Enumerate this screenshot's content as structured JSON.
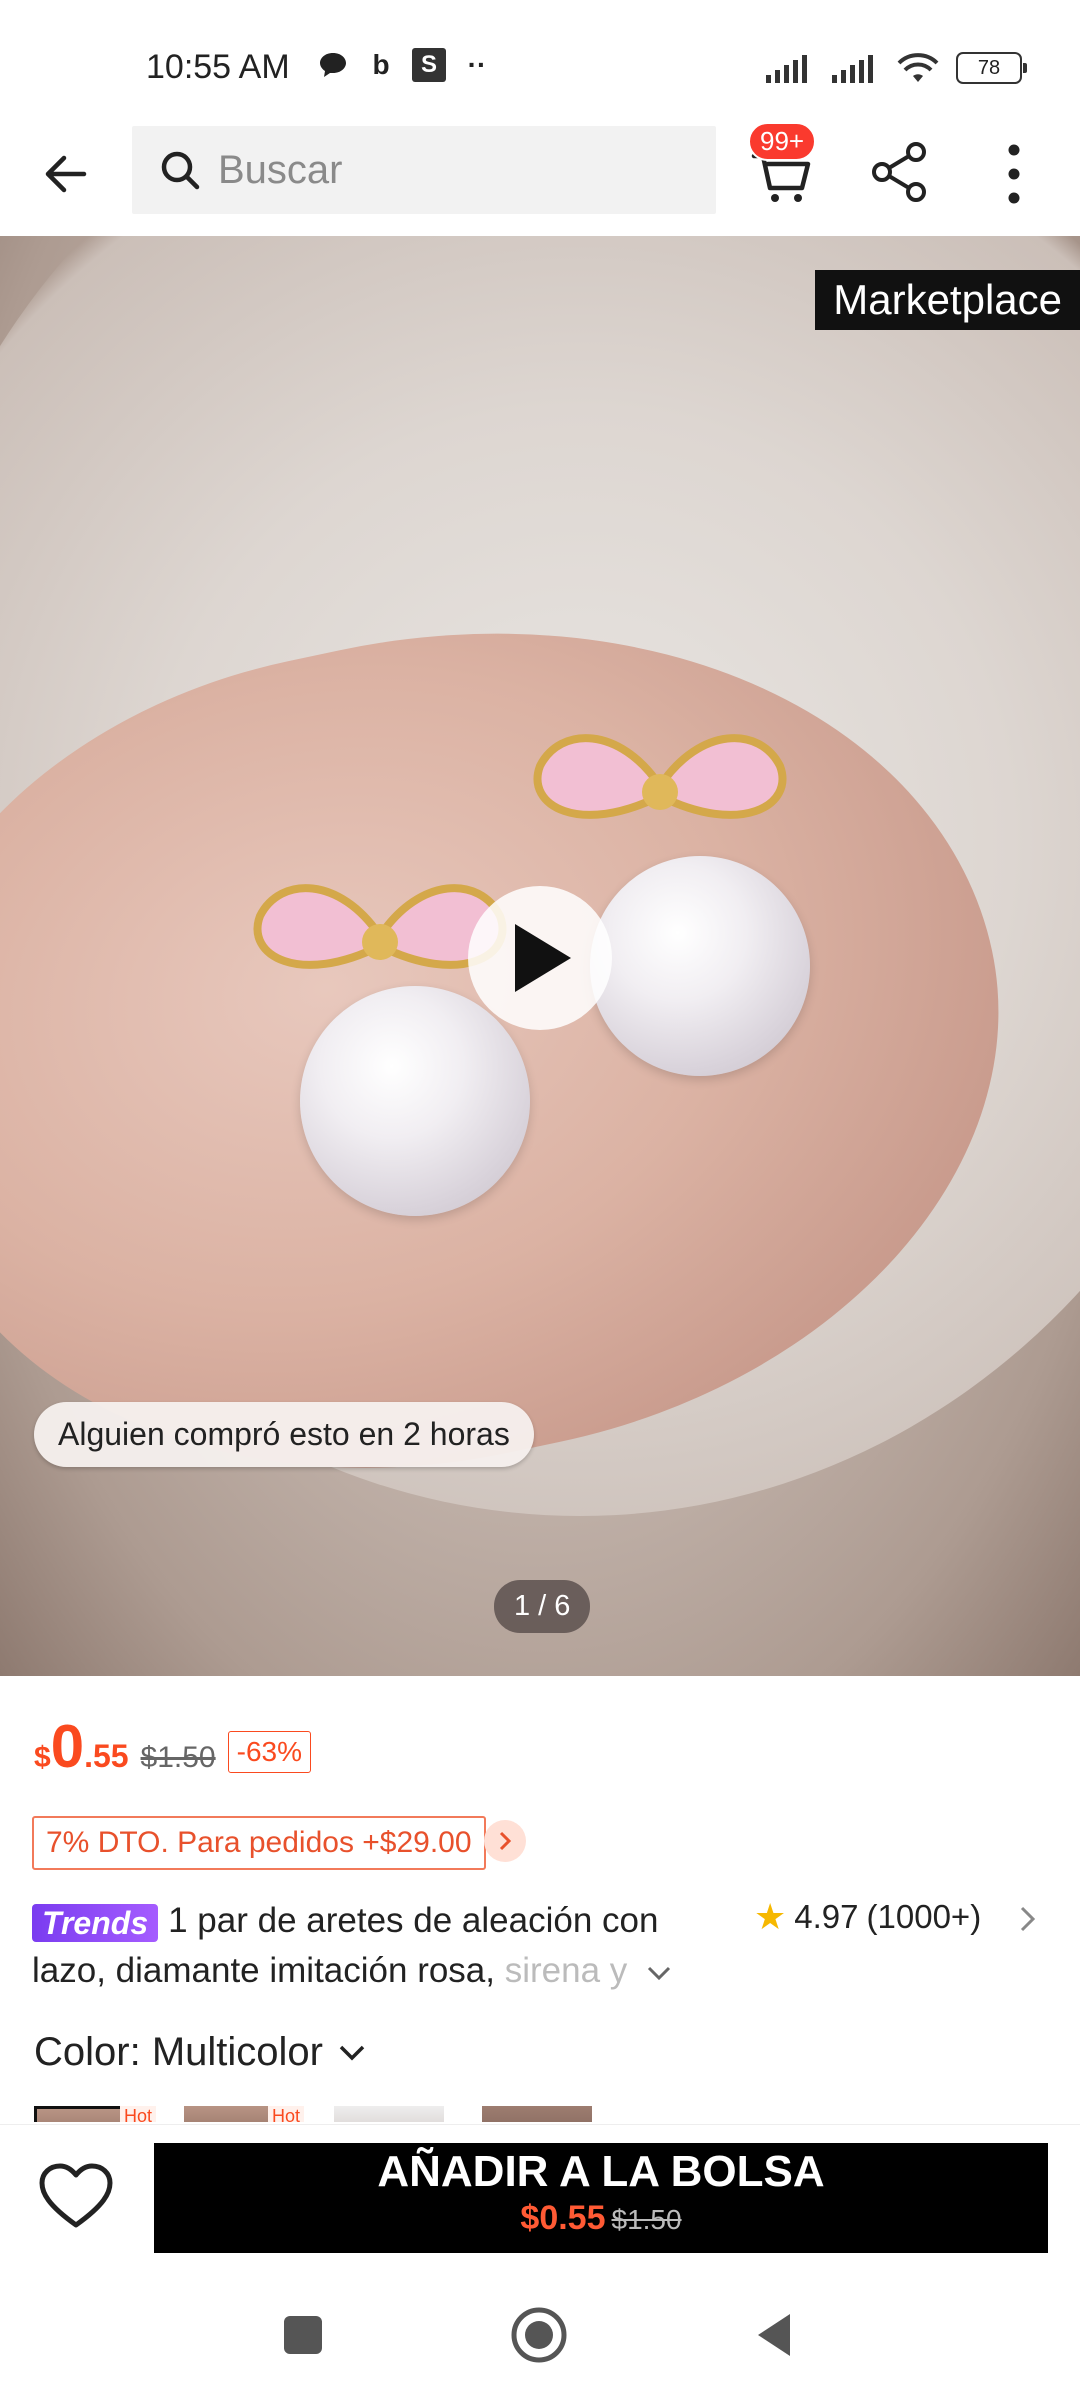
{
  "status_bar": {
    "time": "10:55 AM",
    "battery": "78",
    "icons": [
      "chat-icon",
      "b-icon",
      "s-icon",
      "more-dots-icon",
      "signal-icon",
      "signal-icon-2",
      "wifi-icon",
      "battery-icon"
    ]
  },
  "topnav": {
    "search_placeholder": "Buscar",
    "cart_badge": "99+"
  },
  "hero": {
    "tag": "Marketplace",
    "toast": "Alguien compró esto en 2 horas",
    "pager": "1 / 6"
  },
  "price": {
    "currency": "$",
    "integer": "0",
    "decimal": ".55",
    "original": "$1.50",
    "discount": "-63%"
  },
  "promo": {
    "text": "7% DTO. Para pedidos +$29.00"
  },
  "product": {
    "badge": "Trends",
    "title_main": "1 par de aretes de aleación con lazo, diamante imitación rosa, ",
    "title_fade": "sirena y",
    "rating": "4.97",
    "reviews": "(1000+)"
  },
  "color": {
    "label": "Color: Multicolor",
    "hot_label": "Hot"
  },
  "action": {
    "add_label": "AÑADIR A LA BOLSA",
    "price": "$0.55",
    "original": "$1.50"
  },
  "colors": {
    "accent": "#fa4a1f",
    "trends": "#8a45f5",
    "star": "#f6b800"
  }
}
